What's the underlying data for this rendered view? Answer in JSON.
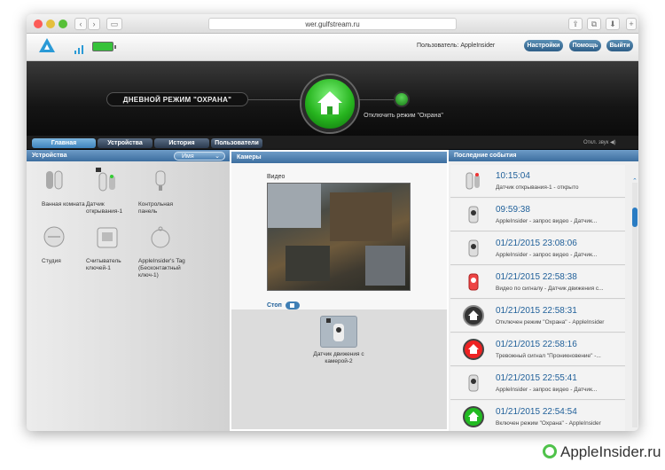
{
  "browser": {
    "url": "wer.gulfstream.ru"
  },
  "header": {
    "user_label": "Пользователь: AppleInsider",
    "buttons": [
      "Настройки",
      "Помощь",
      "Выйти"
    ]
  },
  "banner": {
    "mode": "ДНЕВНОЙ РЕЖИМ \"ОХРАНА\"",
    "disable": "Отключить режим \"Охрана\""
  },
  "nav": {
    "tabs": [
      "Главная",
      "Устройства",
      "История",
      "Пользователи"
    ],
    "sound": "Откл. звук"
  },
  "devices": {
    "title": "Устройства",
    "sort": "Имя",
    "items": [
      "Ванная комната",
      "Датчик открывания-1",
      "Контрольная панель",
      "Студия",
      "Считыватель ключей-1",
      "AppleInsider's Tag (Бесконтактный ключ-1)"
    ]
  },
  "cameras": {
    "title": "Камеры",
    "video_label": "Видео",
    "stop_label": "Стоп",
    "camera_name": "Датчик движения с камерой-2"
  },
  "events": {
    "title": "Последние события",
    "items": [
      {
        "time": "10:15:04",
        "desc": "Датчик открывания-1 - открыто",
        "icon": "door-sensor-icon"
      },
      {
        "time": "09:59:38",
        "desc": "AppleInsider - запрос видео - Датчик...",
        "icon": "camera-sensor-icon"
      },
      {
        "time": "01/21/2015 23:08:06",
        "desc": "AppleInsider - запрос видео - Датчик...",
        "icon": "camera-sensor-icon"
      },
      {
        "time": "01/21/2015 22:58:38",
        "desc": "Видео по сигналу - Датчик движения с...",
        "icon": "camera-alarm-icon"
      },
      {
        "time": "01/21/2015 22:58:31",
        "desc": "Отключен режим \"Охрана\" - AppleInsider",
        "icon": "house-gray-icon"
      },
      {
        "time": "01/21/2015 22:58:16",
        "desc": "Тревожный сигнал \"Проникновение\" -...",
        "icon": "house-red-icon"
      },
      {
        "time": "01/21/2015 22:55:41",
        "desc": "AppleInsider - запрос видео - Датчик...",
        "icon": "camera-sensor-icon"
      },
      {
        "time": "01/21/2015 22:54:54",
        "desc": "Включен режим \"Охрана\" - AppleInsider",
        "icon": "house-green-icon"
      }
    ]
  },
  "watermark": "AppleInsider.ru"
}
